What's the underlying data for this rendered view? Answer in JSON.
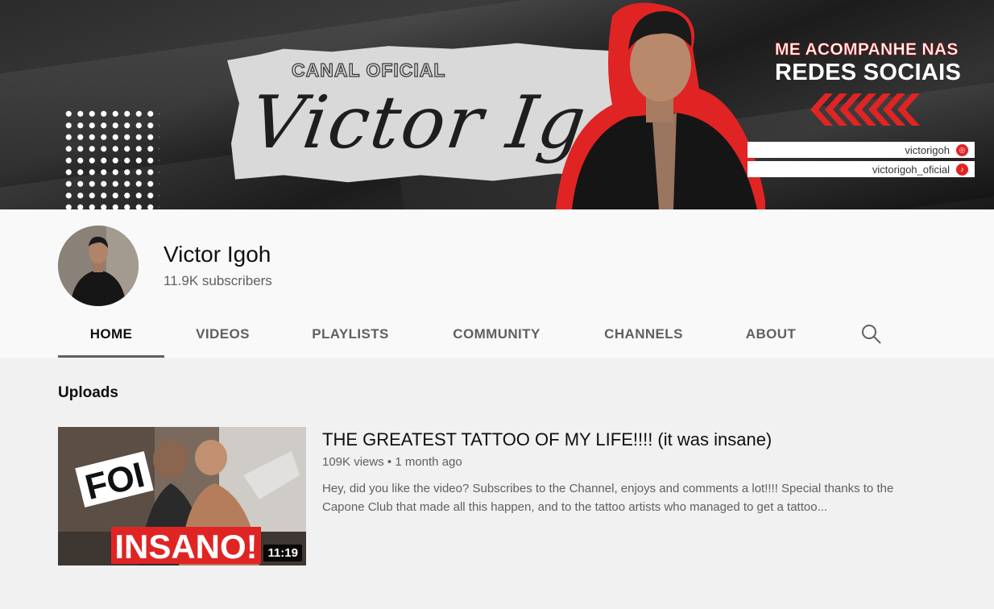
{
  "banner": {
    "canal_label": "CANAL OFICIAL",
    "script_name": "Victor Igoh",
    "cta_line1": "ME ACOMPANHE NAS",
    "cta_line2": "REDES SOCIAIS",
    "socials": [
      {
        "handle": "victorigoh",
        "icon": "instagram-icon"
      },
      {
        "handle": "victorigoh_oficial",
        "icon": "tiktok-icon"
      }
    ],
    "accent_color": "#e02424"
  },
  "channel": {
    "name": "Victor Igoh",
    "subscribers": "11.9K subscribers"
  },
  "tabs": [
    {
      "label": "HOME",
      "active": true
    },
    {
      "label": "VIDEOS"
    },
    {
      "label": "PLAYLISTS"
    },
    {
      "label": "COMMUNITY"
    },
    {
      "label": "CHANNELS"
    },
    {
      "label": "ABOUT"
    }
  ],
  "search_icon": "search-icon",
  "uploads": {
    "title": "Uploads",
    "video": {
      "title": "THE GREATEST TATTOO OF MY LIFE!!!! (it was insane)",
      "views": "109K views",
      "separator": "•",
      "age": "1 month ago",
      "description": "Hey, did you like the video? Subscribes to the Channel, enjoys and comments a lot!!!! Special thanks to the Capone Club that made all this happen, and to the tattoo artists who managed to get a tattoo...",
      "duration": "11:19",
      "thumb_text_top": "FOI",
      "thumb_text_bottom": "INSANO!"
    }
  }
}
